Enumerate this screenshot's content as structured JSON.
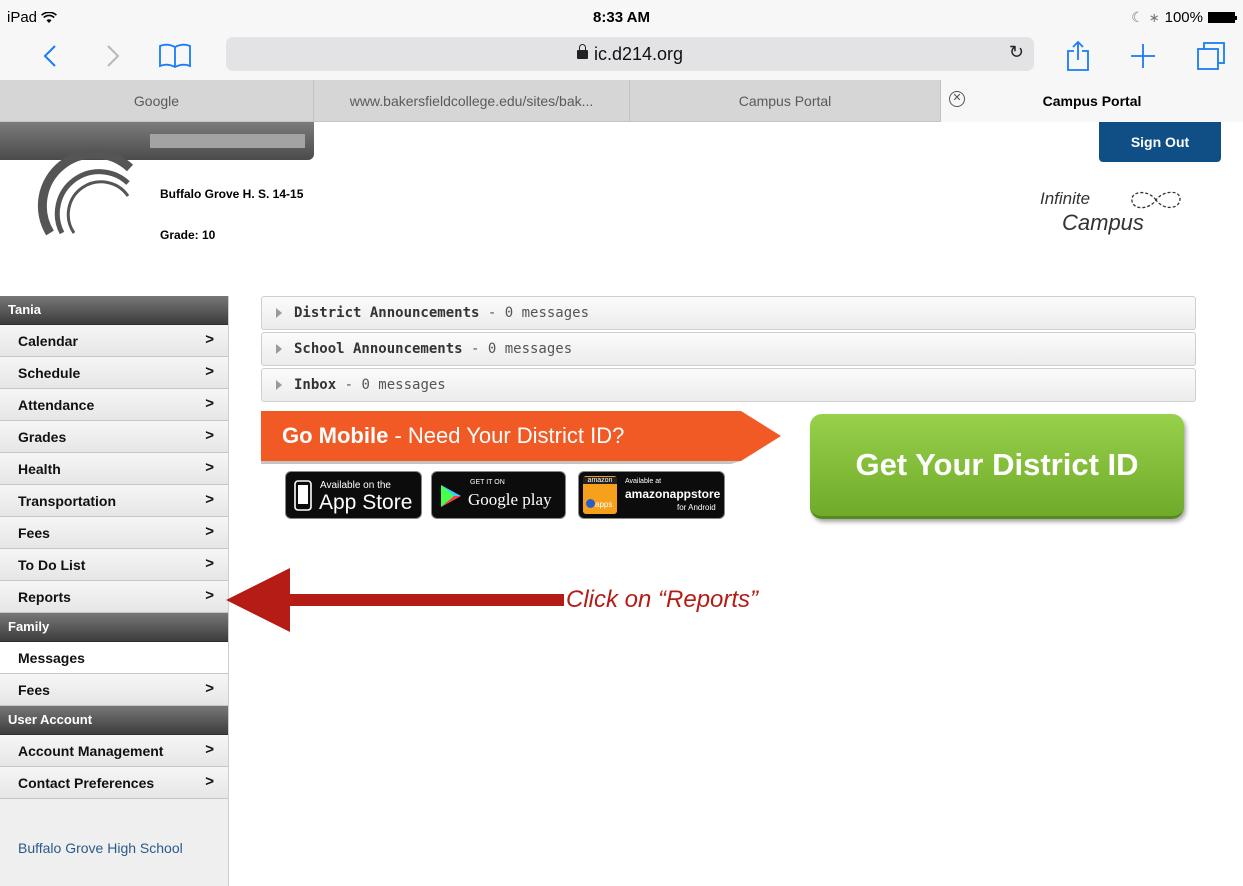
{
  "status_bar": {
    "device": "iPad",
    "time": "8:33 AM",
    "battery": "100%"
  },
  "browser": {
    "url": "ic.d214.org",
    "tabs": [
      {
        "label": "Google"
      },
      {
        "label": "www.bakersfieldcollege.edu/sites/bak..."
      },
      {
        "label": "Campus Portal"
      },
      {
        "label": "Campus Portal",
        "active": true
      }
    ]
  },
  "header": {
    "school": "Buffalo Grove H. S. 14-15",
    "grade": "Grade: 10",
    "sign_out": "Sign Out",
    "logo_line1": "Infinite",
    "logo_line2": "Campus"
  },
  "sidebar": {
    "student_header": "Tania",
    "student_items": [
      {
        "label": "Calendar"
      },
      {
        "label": "Schedule"
      },
      {
        "label": "Attendance"
      },
      {
        "label": "Grades"
      },
      {
        "label": "Health"
      },
      {
        "label": "Transportation"
      },
      {
        "label": "Fees"
      },
      {
        "label": "To Do List"
      },
      {
        "label": "Reports"
      }
    ],
    "family_header": "Family",
    "family_items": [
      {
        "label": "Messages"
      },
      {
        "label": "Fees"
      }
    ],
    "account_header": "User Account",
    "account_items": [
      {
        "label": "Account Management"
      },
      {
        "label": "Contact Preferences"
      }
    ],
    "footer": "Buffalo Grove High School"
  },
  "announcements": [
    {
      "title": "District Announcements",
      "count": " - 0 messages"
    },
    {
      "title": "School Announcements",
      "count": " - 0 messages"
    },
    {
      "title": "Inbox",
      "count": " - 0 messages"
    }
  ],
  "mobile_banner": {
    "go_mobile": "Go Mobile",
    "need_id": " - Need Your District ID?",
    "app_store_small": "Available on the",
    "app_store_big": "App Store",
    "google_small": "GET IT ON",
    "google_big": "Google play",
    "amazon_small": "Available at",
    "amazon_big": "amazonappstore",
    "amazon_sub": "for Android",
    "amazon_logo": "amazon",
    "amazon_apps": "apps",
    "get_id": "Get Your District ID"
  },
  "annotation": {
    "text": "Click on “Reports”",
    "color": "#b51c16"
  },
  "colors": {
    "sign_out_bg": "#0f4f85",
    "get_id_bg": "#7dbb33",
    "go_mobile_bg": "#f15a24"
  }
}
